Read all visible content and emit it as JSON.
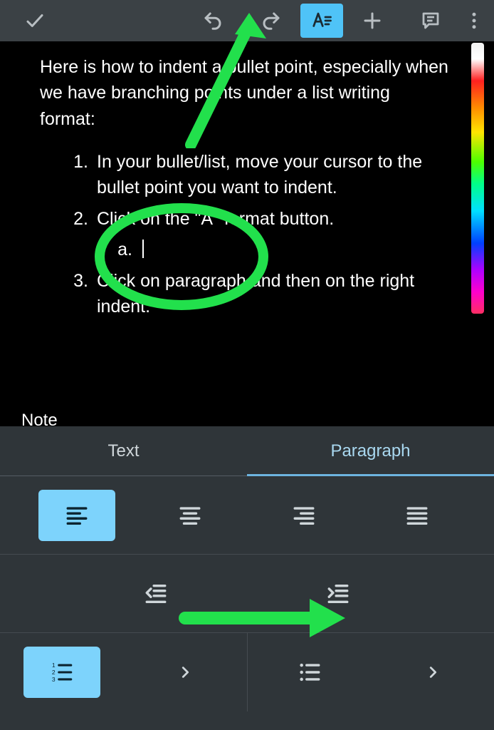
{
  "toolbar": {
    "accept": "check-icon",
    "undo": "undo-icon",
    "redo": "redo-icon",
    "format": "text-format-icon",
    "insert": "plus-icon",
    "comment": "comment-icon",
    "overflow": "more-vert-icon"
  },
  "document": {
    "intro": "Here is how to indent a bullet point, especially when we have branching points under a list writing format:",
    "list": [
      {
        "n": "1.",
        "text": "In your bullet/list, move your cursor to the bullet point you want to indent."
      },
      {
        "n": "2.",
        "text": "Click on the \"A\" format button.",
        "sub": [
          {
            "n": "a.",
            "text": ""
          }
        ]
      },
      {
        "n": "3.",
        "text": "Click on paragraph and then on the right indent."
      }
    ],
    "truncated_label": "Note"
  },
  "panel": {
    "tabs": {
      "text": "Text",
      "paragraph": "Paragraph",
      "active": "paragraph"
    },
    "align": {
      "left": "align-left-icon",
      "center": "align-center-icon",
      "right": "align-right-icon",
      "justify": "align-justify-icon",
      "selected": "left"
    },
    "indent": {
      "decrease": "indent-decrease-icon",
      "increase": "indent-increase-icon"
    },
    "lists": {
      "numbered": "numbered-list-icon",
      "bulleted": "bulleted-list-icon",
      "selected": "numbered"
    }
  },
  "annotations": {
    "arrow_to_format": "green-arrow",
    "circle_item2": "green-ellipse",
    "arrow_to_indent": "green-arrow"
  },
  "colors": {
    "accent": "#7dd3fc",
    "annotation": "#22e04c"
  }
}
